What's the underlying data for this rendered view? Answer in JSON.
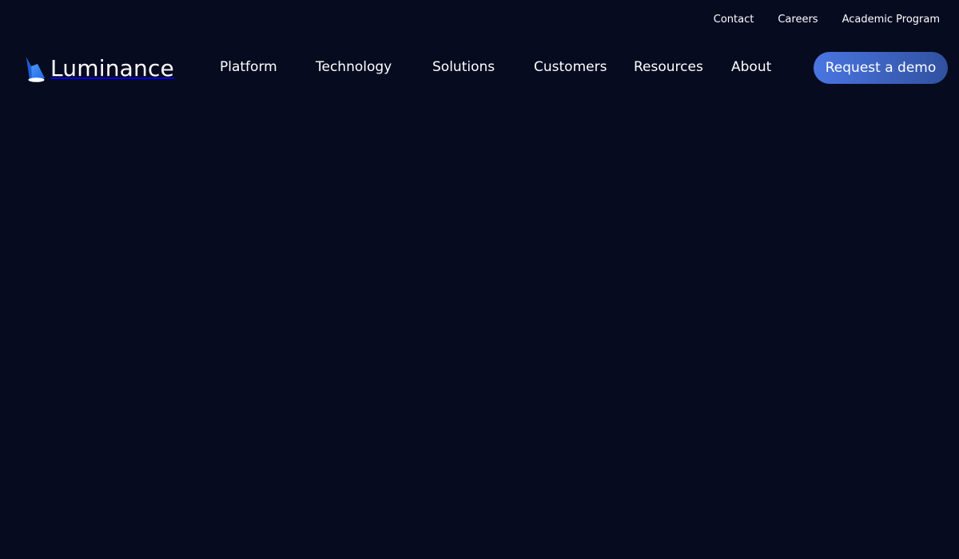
{
  "utility_nav": {
    "contact": "Contact",
    "careers": "Careers",
    "academic_program": "Academic Program"
  },
  "brand": {
    "name": "Luminance",
    "logo_icon": "luminance-logo-mark-icon",
    "colors": {
      "background": "#070b20",
      "accent": "#4a76e2"
    }
  },
  "main_nav": {
    "items": [
      "Platform",
      "Technology",
      "Solutions",
      "Customers",
      "Resources",
      "About"
    ]
  },
  "cta": {
    "label": "Request a demo"
  }
}
